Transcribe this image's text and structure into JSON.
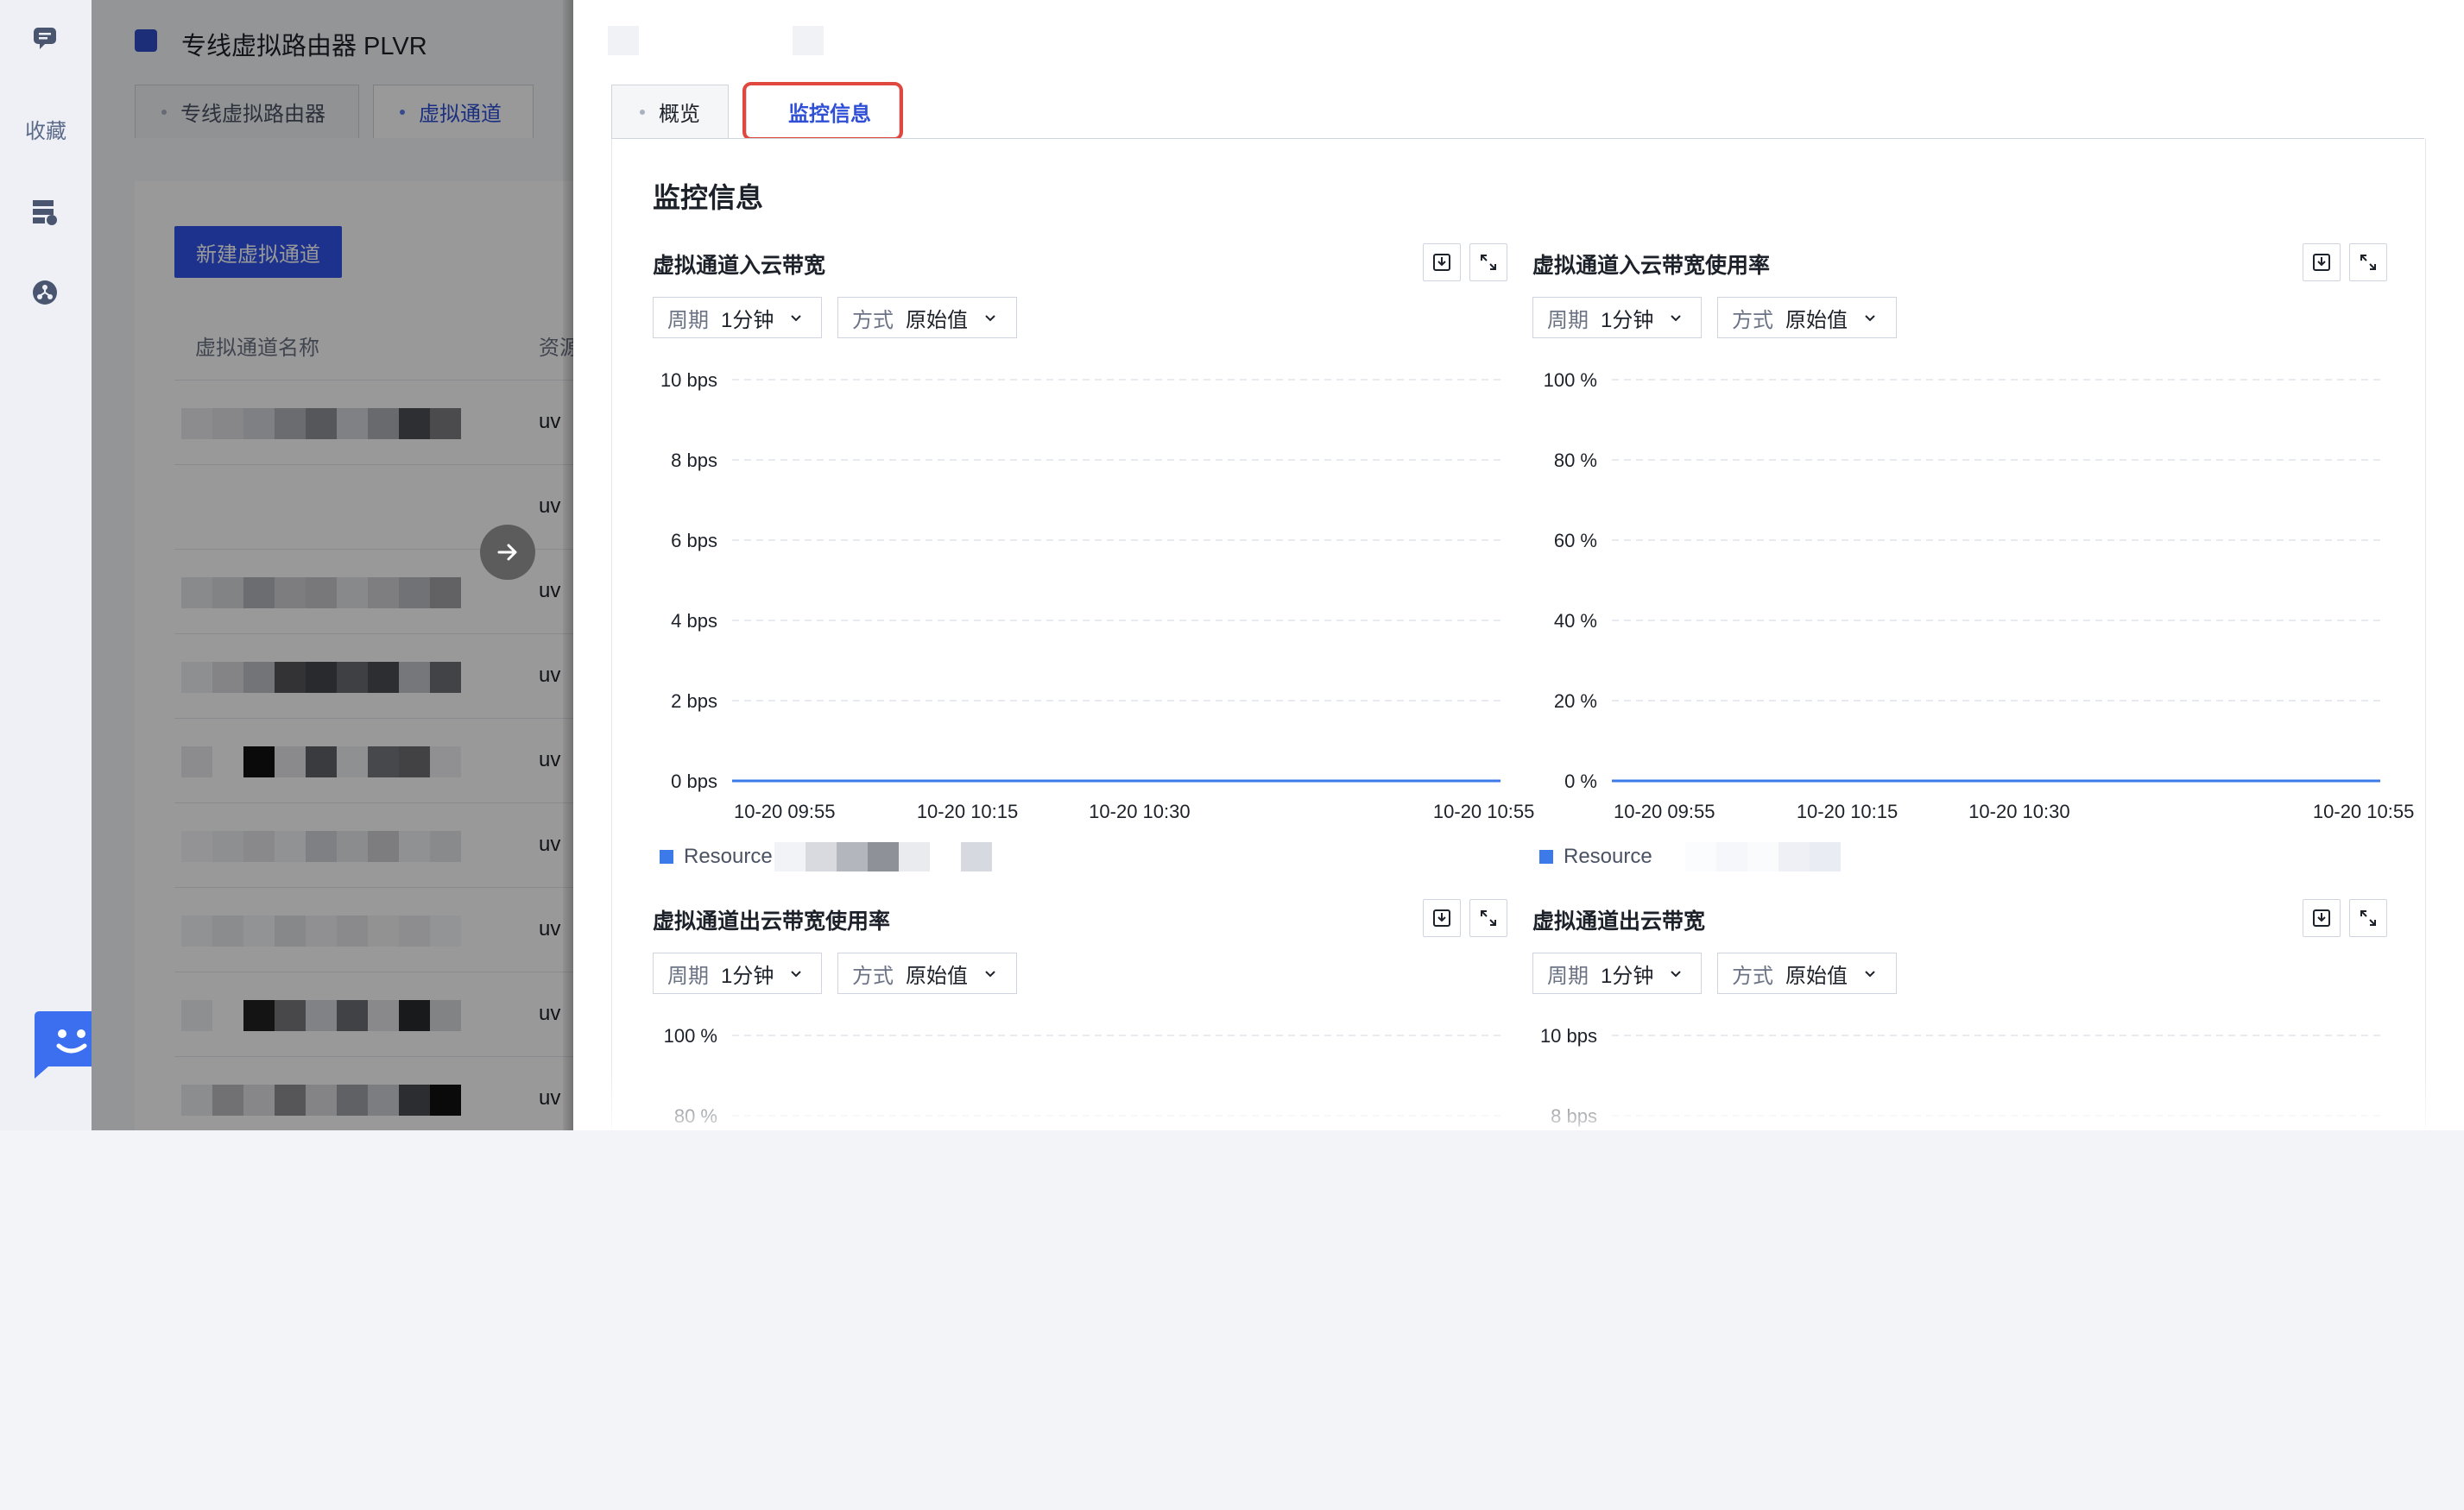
{
  "sidebar": {
    "favorites_label": "收藏",
    "icons": [
      "message-icon",
      "database-icon",
      "network-icon"
    ]
  },
  "background_page": {
    "title": "专线虚拟路由器 PLVR",
    "tabs": [
      {
        "label": "专线虚拟路由器",
        "active": false
      },
      {
        "label": "虚拟通道",
        "active": true
      }
    ],
    "create_button": "新建虚拟通道",
    "columns": [
      "虚拟通道名称",
      "资源"
    ],
    "row_prefix": "uv",
    "row_count": 9
  },
  "drawer": {
    "tabs": [
      {
        "label": "概览",
        "active": false
      },
      {
        "label": "监控信息",
        "active": true
      }
    ],
    "section_title": "监控信息",
    "period_label": "周期",
    "period_value": "1分钟",
    "mode_label": "方式",
    "mode_value": "原始值",
    "legend_label": "Resource",
    "accent_color": "#3b7ae8",
    "highlight_color": "#e0483f"
  },
  "chart_data": [
    {
      "type": "line",
      "title": "虚拟通道入云带宽",
      "y_ticks": [
        "10 bps",
        "8 bps",
        "6 bps",
        "4 bps",
        "2 bps",
        "0 bps"
      ],
      "ylim": [
        0,
        10
      ],
      "x_ticks": [
        "10-20 09:55",
        "10-20 10:15",
        "10-20 10:30",
        "10-20 10:55"
      ],
      "series": [
        {
          "name": "Resource",
          "values": [
            0,
            0,
            0,
            0
          ]
        }
      ],
      "legend": "bottom-left",
      "grid": true
    },
    {
      "type": "line",
      "title": "虚拟通道入云带宽使用率",
      "y_ticks": [
        "100 %",
        "80 %",
        "60 %",
        "40 %",
        "20 %",
        "0 %"
      ],
      "ylim": [
        0,
        100
      ],
      "x_ticks": [
        "10-20 09:55",
        "10-20 10:15",
        "10-20 10:30",
        "10-20 10:55"
      ],
      "series": [
        {
          "name": "Resource",
          "values": [
            0,
            0,
            0,
            0
          ]
        }
      ],
      "legend": "bottom-left",
      "grid": true
    },
    {
      "type": "line",
      "title": "虚拟通道出云带宽使用率",
      "y_ticks": [
        "100 %",
        "80 %"
      ],
      "ylim": [
        0,
        100
      ],
      "x_ticks": [],
      "series": [],
      "grid": true
    },
    {
      "type": "line",
      "title": "虚拟通道出云带宽",
      "y_ticks": [
        "10 bps",
        "8 bps"
      ],
      "ylim": [
        0,
        10
      ],
      "x_ticks": [],
      "series": [],
      "grid": true
    }
  ]
}
